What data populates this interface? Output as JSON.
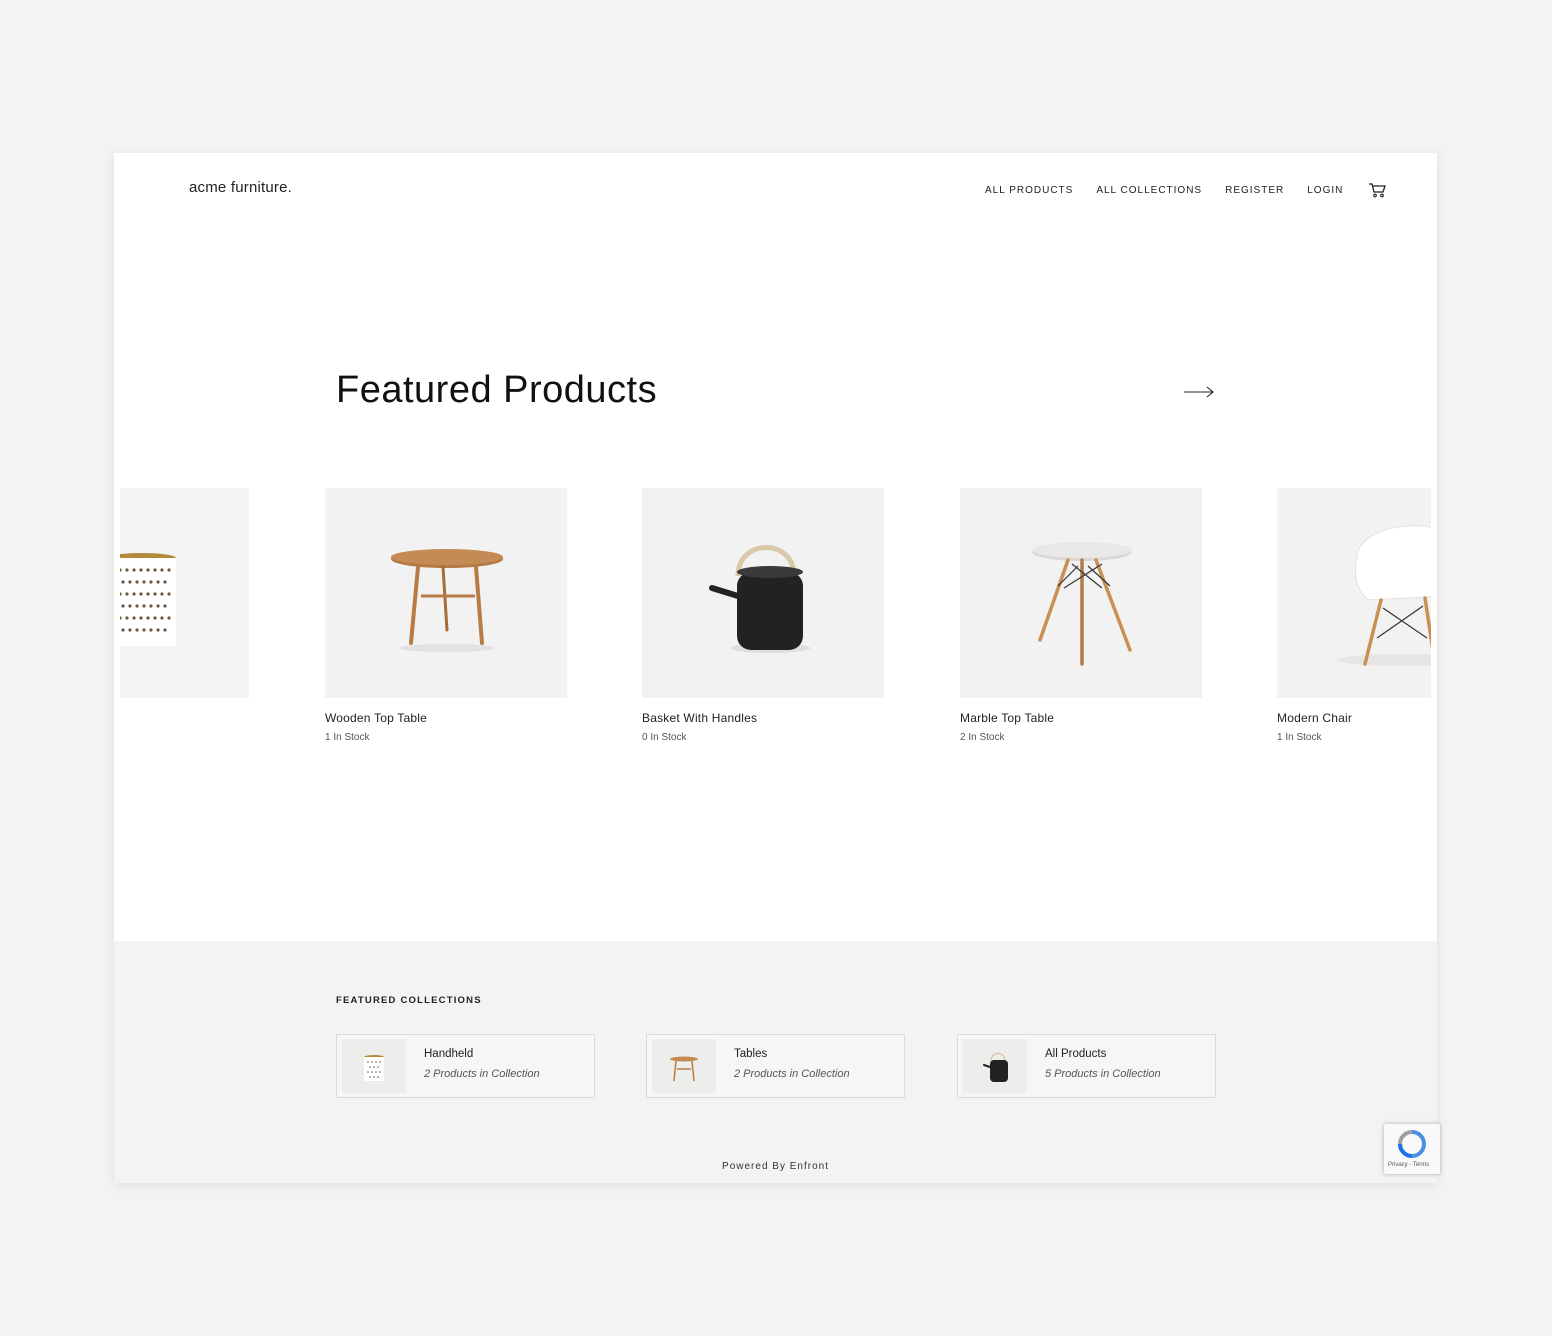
{
  "header": {
    "logo": "acme furniture.",
    "nav": [
      "ALL PRODUCTS",
      "ALL COLLECTIONS",
      "REGISTER",
      "LOGIN"
    ]
  },
  "featured": {
    "title": "Featured Products",
    "products": [
      {
        "name": "",
        "stock": ""
      },
      {
        "name": "Wooden Top Table",
        "stock": "1 In Stock"
      },
      {
        "name": "Basket With Handles",
        "stock": "0 In Stock"
      },
      {
        "name": "Marble Top Table",
        "stock": "2 In Stock"
      },
      {
        "name": "Modern Chair",
        "stock": "1 In Stock"
      }
    ]
  },
  "collections": {
    "title": "FEATURED COLLECTIONS",
    "items": [
      {
        "name": "Handheld",
        "count": "2 Products in Collection"
      },
      {
        "name": "Tables",
        "count": "2 Products in Collection"
      },
      {
        "name": "All Products",
        "count": "5 Products in Collection"
      }
    ]
  },
  "footer": {
    "powered": "Powered By Enfront"
  },
  "recaptcha": {
    "links": "Privacy - Terms"
  }
}
